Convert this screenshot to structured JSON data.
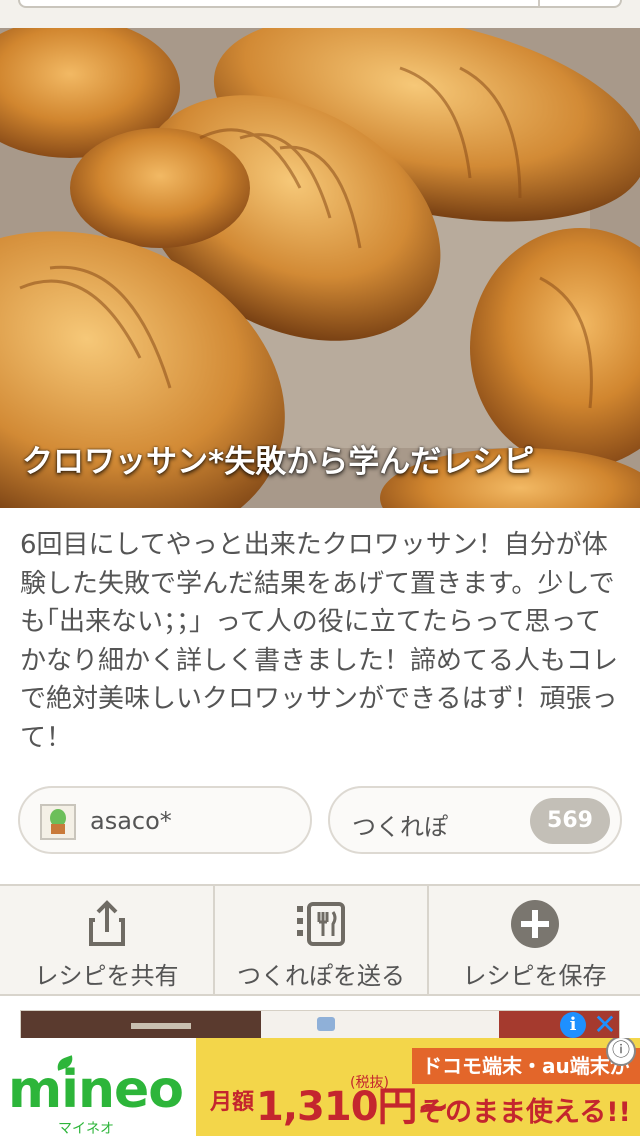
{
  "recipe": {
    "title": "クロワッサン*失敗から学んだレシピ",
    "description": "6回目にしてやっと出来たクロワッサン！自分が体験した失敗で学んだ結果をあげて置きます。少しでも｢出来ない；；」って人の役に立てたらって思ってかなり細かく詳しく書きました！諦めてる人もコレで絶対美味しいクロワッサンができるはず！頑張って！"
  },
  "author": {
    "name": "asaco*"
  },
  "tsukurepo": {
    "label": "つくれぽ",
    "count": "569"
  },
  "actions": [
    {
      "label": "レシピを共有",
      "icon": "share-icon"
    },
    {
      "label": "つくれぽを送る",
      "icon": "send-report-icon"
    },
    {
      "label": "レシピを保存",
      "icon": "save-plus-icon"
    }
  ],
  "ad": {
    "brand": "mineo",
    "brand_kana": "マイネオ",
    "price_label": "月額",
    "price": "1,310円~",
    "tax_note": "(税抜)",
    "line1": "ドコモ端末・au端末が",
    "line2": "そのまま使える!!",
    "adchoices": "i",
    "close": "✕",
    "info": "ⓘ"
  },
  "colors": {
    "accent_green": "#2db53a",
    "ad_red": "#c4262e",
    "count_badge": "#c3bfb7"
  }
}
